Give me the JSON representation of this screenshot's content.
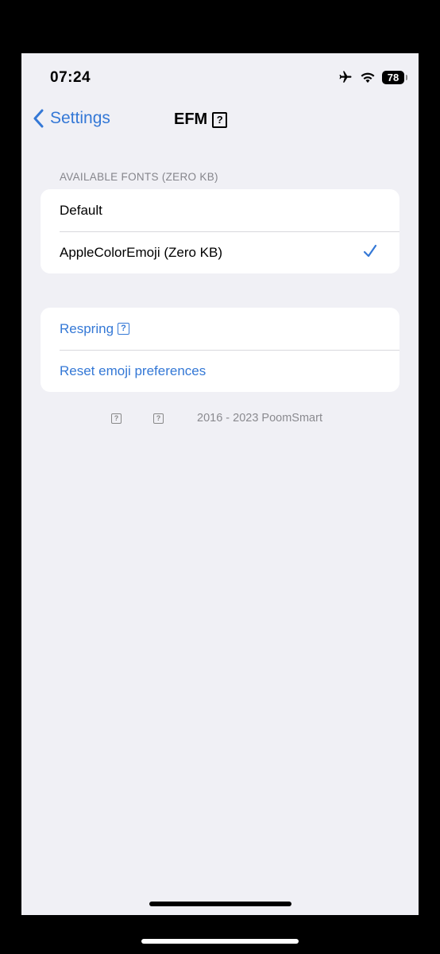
{
  "status_bar": {
    "time": "07:24",
    "battery": "78"
  },
  "nav": {
    "back_label": "Settings",
    "title": "EFM",
    "title_glyph": "?"
  },
  "fonts_section": {
    "header": "AVAILABLE FONTS (ZERO KB)",
    "items": [
      {
        "label": "Default",
        "selected": false
      },
      {
        "label": "AppleColorEmoji (Zero KB)",
        "selected": true
      }
    ]
  },
  "actions": {
    "respring_label": "Respring",
    "respring_glyph": "?",
    "reset_label": "Reset emoji preferences"
  },
  "footer": {
    "glyph1": "?",
    "glyph2": "?",
    "copyright": "2016 - 2023 PoomSmart"
  },
  "colors": {
    "accent": "#3478d6",
    "background": "#f0f0f5",
    "card": "#ffffff"
  }
}
